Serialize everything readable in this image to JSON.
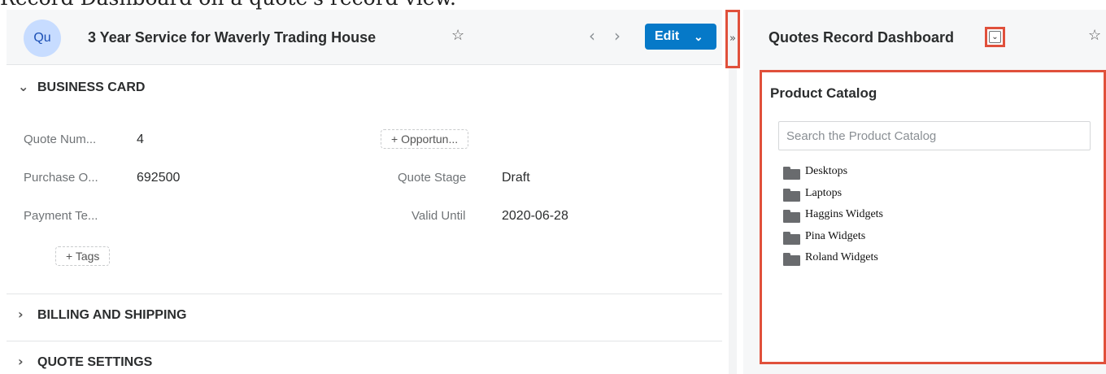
{
  "caption": "Record Dashboard on a quote's record view.",
  "record": {
    "avatar_initials": "Qu",
    "title": "3 Year Service for Waverly Trading House",
    "star_icon": "☆",
    "prev_icon": "‹",
    "next_icon": "›",
    "edit_label": "Edit",
    "edit_caret": "⌄"
  },
  "panels": {
    "business_card": "BUSINESS CARD",
    "billing": "BILLING AND SHIPPING",
    "settings": "QUOTE SETTINGS",
    "expanded_chevron": "⌄",
    "collapsed_chevron": "›"
  },
  "fields": {
    "quote_number": {
      "label": "Quote Num...",
      "value": "4"
    },
    "opportunity_pill": "+ Opportun...",
    "purchase_order": {
      "label": "Purchase O...",
      "value": "692500"
    },
    "quote_stage": {
      "label": "Quote Stage",
      "value": "Draft"
    },
    "payment_terms": {
      "label": "Payment Te..."
    },
    "valid_until": {
      "label": "Valid Until",
      "value": "2020-06-28"
    },
    "tags_pill": "+ Tags"
  },
  "splitter": {
    "toggle_icon": "»"
  },
  "dashboard": {
    "title": "Quotes Record Dashboard",
    "dropdown_icon": "⌄",
    "star_icon": "☆",
    "dashlet": {
      "title": "Product Catalog",
      "search_placeholder": "Search the Product Catalog",
      "items": [
        "Desktops",
        "Laptops",
        "Haggins Widgets",
        "Pina Widgets",
        "Roland Widgets"
      ]
    }
  },
  "colors": {
    "accent": "#0679c8",
    "highlight": "#e0503b",
    "folder": "#696b6e",
    "avatar_bg": "#c7dcff"
  }
}
